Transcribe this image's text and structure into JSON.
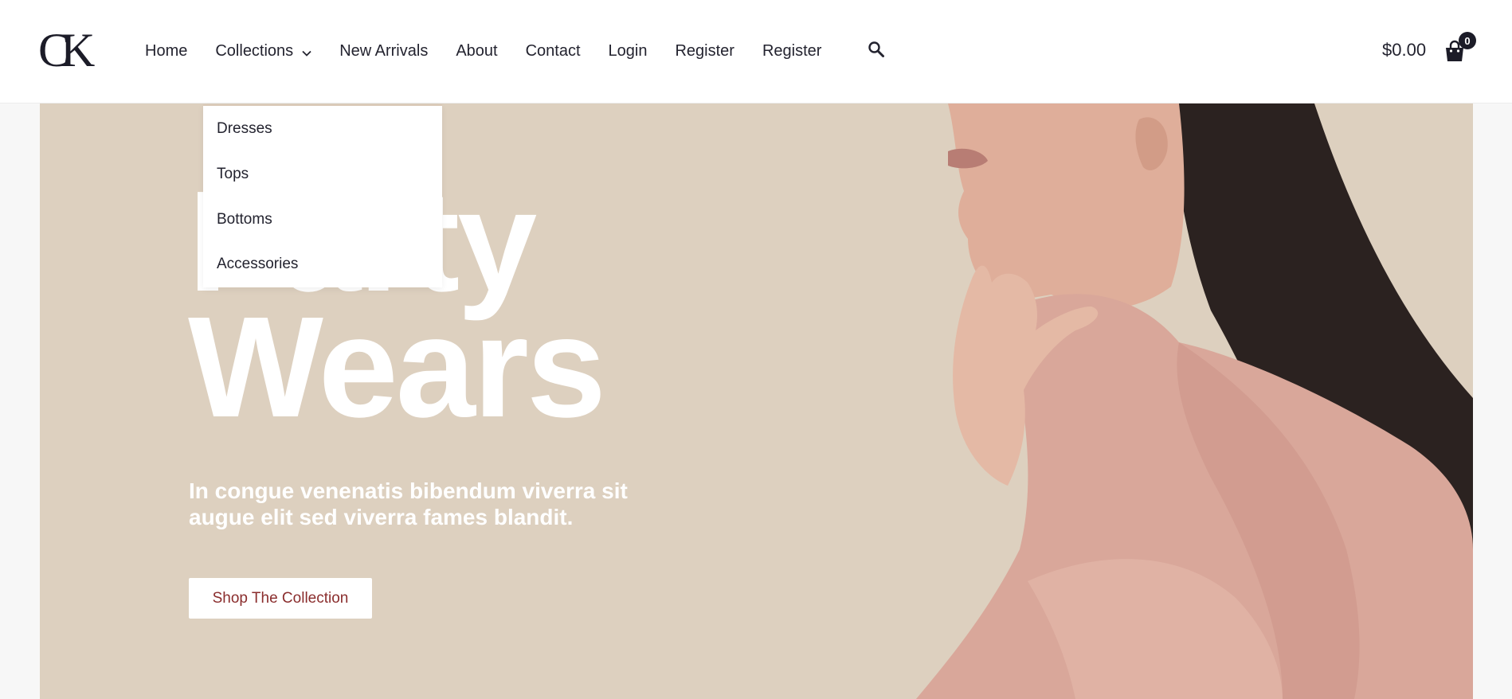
{
  "header": {
    "logo_text": "CK",
    "nav": {
      "home": "Home",
      "collections": "Collections",
      "new_arrivals": "New Arrivals",
      "about": "About",
      "contact": "Contact",
      "login": "Login",
      "register_1": "Register",
      "register_2": "Register"
    },
    "cart_total": "$0.00",
    "cart_count": "0"
  },
  "dropdown": {
    "items": [
      "Dresses",
      "Tops",
      "Bottoms",
      "Accessories"
    ]
  },
  "hero": {
    "title_line1": "Party",
    "title_line2": "Wears",
    "subtitle": "In congue venenatis bibendum viverra sit augue elit sed viverra fames blandit.",
    "button_label": "Shop The Collection"
  },
  "colors": {
    "hero_bg": "#ddd0bf",
    "button_text": "#8a2d2d",
    "text_dark": "#1e1e2a"
  },
  "icons": {
    "search": "search-icon",
    "cart": "shopping-bag-icon",
    "dropdown": "chevron-down-icon"
  }
}
